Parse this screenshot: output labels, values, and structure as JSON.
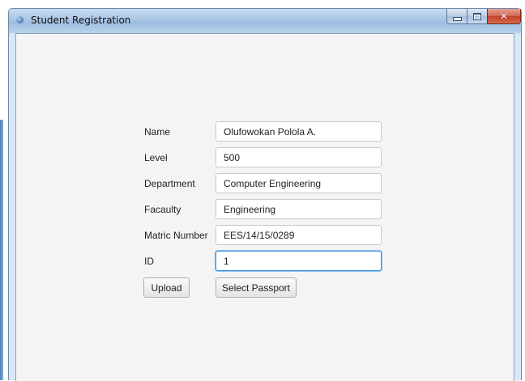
{
  "window": {
    "title": "Student Registration",
    "controls": {
      "minimize": "minimize-icon",
      "maximize": "maximize-icon",
      "close": "close-icon"
    }
  },
  "form": {
    "name": {
      "label": "Name",
      "value": "Olufowokan Polola A."
    },
    "level": {
      "label": "Level",
      "value": "500"
    },
    "department": {
      "label": "Department",
      "value": "Computer Engineering"
    },
    "faculty": {
      "label": "Facaulty",
      "value": "Engineering"
    },
    "matric": {
      "label": "Matric Number",
      "value": "EES/14/15/0289"
    },
    "id": {
      "label": "ID",
      "value": "1"
    }
  },
  "buttons": {
    "upload": "Upload",
    "select_passport": "Select Passport"
  },
  "colors": {
    "focus_border": "#3d8ee0",
    "client_bg": "#f4f4f4",
    "close_button": "#c2412a"
  }
}
